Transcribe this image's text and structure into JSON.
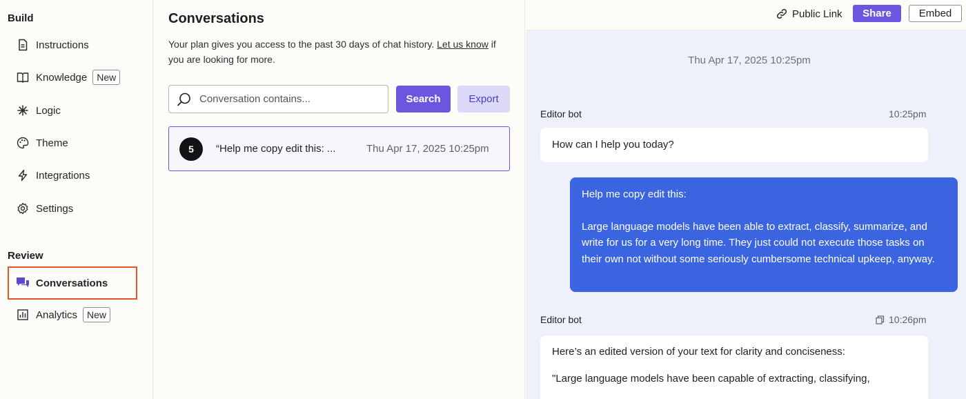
{
  "sidebar": {
    "build_title": "Build",
    "review_title": "Review",
    "build_items": [
      {
        "label": "Instructions",
        "icon": "document-icon"
      },
      {
        "label": "Knowledge",
        "icon": "book-icon",
        "badge": "New"
      },
      {
        "label": "Logic",
        "icon": "asterisk-icon"
      },
      {
        "label": "Theme",
        "icon": "palette-icon"
      },
      {
        "label": "Integrations",
        "icon": "lightning-icon"
      },
      {
        "label": "Settings",
        "icon": "gear-icon"
      }
    ],
    "review_items": [
      {
        "label": "Conversations",
        "icon": "chat-bubbles-icon",
        "active": true
      },
      {
        "label": "Analytics",
        "icon": "bar-chart-icon",
        "badge": "New"
      }
    ]
  },
  "list": {
    "title": "Conversations",
    "plan_text": "Your plan gives you access to the past 30 days of chat history. ",
    "plan_link": "Let us know",
    "plan_text_after": " if you are looking for more.",
    "search_placeholder": "Conversation contains...",
    "search_label": "Search",
    "export_label": "Export",
    "conversations": [
      {
        "count": "5",
        "preview": "“Help me copy edit this: ...",
        "time": "Thu Apr 17, 2025 10:25pm"
      }
    ]
  },
  "chat": {
    "public_link_label": "Public Link",
    "share_label": "Share",
    "embed_label": "Embed",
    "date": "Thu Apr 17, 2025 10:25pm",
    "messages": [
      {
        "sender": "Editor bot",
        "time": "10:25pm",
        "text": "How can I help you today?"
      },
      {
        "role": "user",
        "line1": "Help me copy edit this:",
        "line2": "Large language models have been able to extract, classify, summarize, and write for us for a very long time. They just could not execute those tasks on their own not without some seriously cumbersome technical upkeep, anyway."
      },
      {
        "sender": "Editor bot",
        "time": "10:26pm",
        "text1": "Here’s an edited version of your text for clarity and conciseness:",
        "text2": "\"Large language models have been capable of extracting, classifying,"
      }
    ]
  },
  "colors": {
    "accent": "#6c56e0",
    "user_bubble": "#3b64e0",
    "highlight": "#e8532a"
  }
}
